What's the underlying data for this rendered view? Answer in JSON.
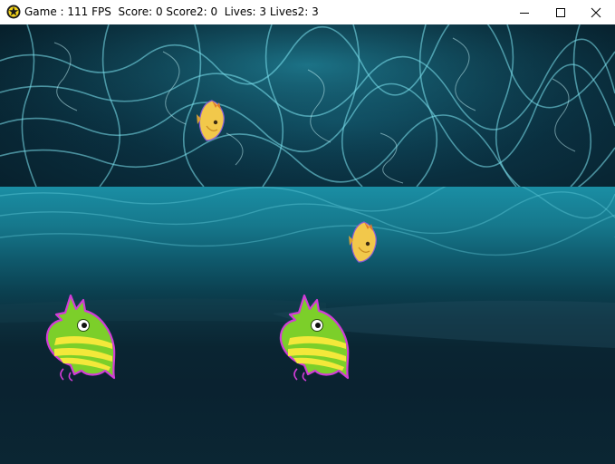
{
  "window": {
    "title": "Game : 111 FPS  Score: 0 Score2: 0  Lives: 3 Lives2: 3",
    "controls": {
      "minimize_icon": "minimize-icon",
      "maximize_icon": "maximize-icon",
      "close_icon": "close-icon"
    },
    "app_icon": "game-app-icon"
  },
  "game": {
    "viewports": [
      {
        "name": "player-1-view",
        "background": "underwater-caustics"
      },
      {
        "name": "player-2-view",
        "background": "deep-ocean"
      }
    ],
    "sprites": [
      {
        "name": "yellow-fish",
        "view": "player-1-view"
      },
      {
        "name": "yellow-fish",
        "view": "player-2-view"
      },
      {
        "name": "green-striped-fish",
        "view": "player-2-view"
      },
      {
        "name": "green-striped-fish",
        "view": "player-2-view"
      }
    ]
  },
  "colors": {
    "titlebar_bg": "#ffffff",
    "water_top": "#0e4a5d",
    "water_highlight": "#5fd4e6",
    "fish_yellow": "#f2c84b",
    "fish_green": "#7ccf2a",
    "fish_outline": "#d23cd8"
  }
}
